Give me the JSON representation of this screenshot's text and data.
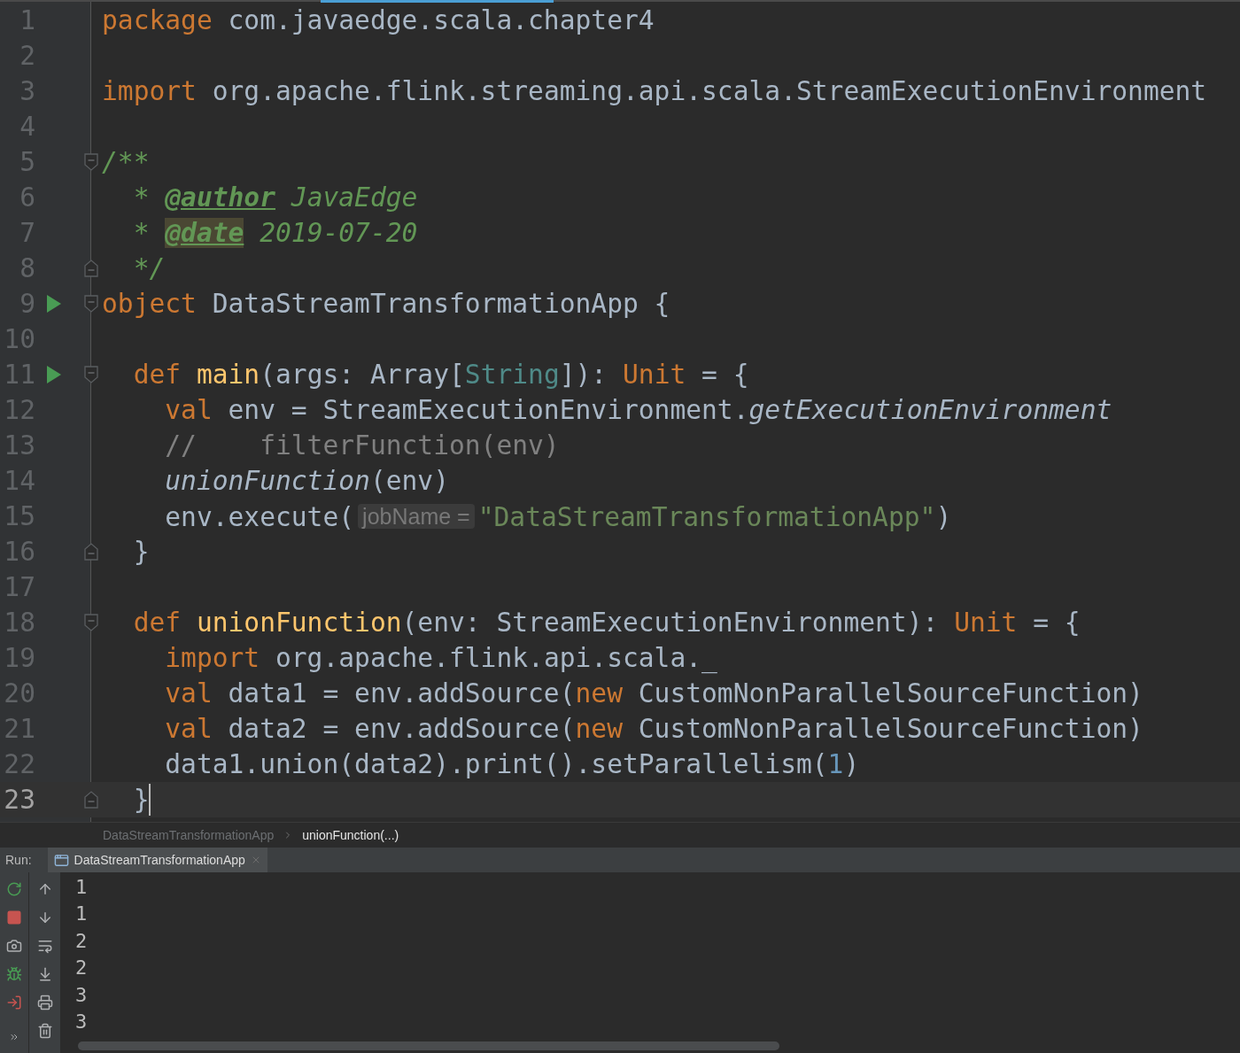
{
  "editor": {
    "lines": [
      {
        "number": "1",
        "run": false,
        "fold_start": false,
        "fold_end": false,
        "current": false,
        "tokens": [
          {
            "kind": "keyword",
            "text": "package"
          },
          {
            "kind": "plain",
            "text": " com.javaedge.scala.chapter4"
          }
        ]
      },
      {
        "number": "2",
        "run": false,
        "fold_start": false,
        "fold_end": false,
        "current": false
      },
      {
        "number": "3",
        "run": false,
        "fold_start": false,
        "fold_end": false,
        "current": false,
        "tokens": [
          {
            "kind": "keyword",
            "text": "import"
          },
          {
            "kind": "plain",
            "text": " org.apache.flink.streaming.api.scala.StreamExecutionEnvironment"
          }
        ]
      },
      {
        "number": "4",
        "run": false,
        "fold_start": false,
        "fold_end": false,
        "current": false
      },
      {
        "number": "5",
        "run": false,
        "fold_start": true,
        "fold_end": false,
        "current": false,
        "tokens": [
          {
            "kind": "doc",
            "text": "/**"
          }
        ]
      },
      {
        "number": "6",
        "run": false,
        "fold_start": false,
        "fold_end": false,
        "current": false,
        "tokens": [
          {
            "kind": "doc",
            "text": "  * "
          },
          {
            "kind": "doctag",
            "text": "@author"
          },
          {
            "kind": "doc",
            "text": " JavaEdge"
          }
        ]
      },
      {
        "number": "7",
        "run": false,
        "fold_start": false,
        "fold_end": false,
        "current": false,
        "tokens": [
          {
            "kind": "doc",
            "text": "  * "
          },
          {
            "kind": "marked",
            "text": "@date"
          },
          {
            "kind": "doc",
            "text": " 2019-07-20"
          }
        ]
      },
      {
        "number": "8",
        "run": false,
        "fold_start": false,
        "fold_end": true,
        "current": false,
        "tokens": [
          {
            "kind": "doc",
            "text": "  */"
          }
        ]
      },
      {
        "number": "9",
        "run": true,
        "fold_start": true,
        "fold_end": false,
        "current": false,
        "tokens": [
          {
            "kind": "keyword",
            "text": "object"
          },
          {
            "kind": "plain",
            "text": " DataStreamTransformationApp {"
          }
        ]
      },
      {
        "number": "10",
        "run": false,
        "fold_start": false,
        "fold_end": false,
        "current": false
      },
      {
        "number": "11",
        "run": true,
        "fold_start": true,
        "fold_end": false,
        "current": false,
        "tokens": [
          {
            "kind": "keyword",
            "text": "  def "
          },
          {
            "kind": "def",
            "text": "main"
          },
          {
            "kind": "plain",
            "text": "(args: Array["
          },
          {
            "kind": "type",
            "text": "String"
          },
          {
            "kind": "plain",
            "text": "]): "
          },
          {
            "kind": "keyword",
            "text": "Unit"
          },
          {
            "kind": "plain",
            "text": " = {"
          }
        ]
      },
      {
        "number": "12",
        "run": false,
        "fold_start": false,
        "fold_end": false,
        "current": false,
        "tokens": [
          {
            "kind": "keyword",
            "text": "    val"
          },
          {
            "kind": "plain",
            "text": " env = StreamExecutionEnvironment."
          },
          {
            "kind": "static",
            "text": "getExecutionEnvironment"
          }
        ]
      },
      {
        "number": "13",
        "run": false,
        "fold_start": false,
        "fold_end": false,
        "current": false,
        "tokens": [
          {
            "kind": "comment",
            "text": "    //    filterFunction(env)"
          }
        ]
      },
      {
        "number": "14",
        "run": false,
        "fold_start": false,
        "fold_end": false,
        "current": false,
        "tokens": [
          {
            "kind": "static",
            "text": "    unionFunction"
          },
          {
            "kind": "plain",
            "text": "(env)"
          }
        ]
      },
      {
        "number": "15",
        "run": false,
        "fold_start": false,
        "fold_end": false,
        "current": false,
        "tokens": [
          {
            "kind": "plain",
            "text": "    env.execute("
          },
          {
            "kind": "hint",
            "text": "jobName ="
          },
          {
            "kind": "string",
            "text": "\"DataStreamTransformationApp\""
          },
          {
            "kind": "plain",
            "text": ")"
          }
        ]
      },
      {
        "number": "16",
        "run": false,
        "fold_start": false,
        "fold_end": true,
        "current": false,
        "tokens": [
          {
            "kind": "plain",
            "text": "  }"
          }
        ]
      },
      {
        "number": "17",
        "run": false,
        "fold_start": false,
        "fold_end": false,
        "current": false
      },
      {
        "number": "18",
        "run": false,
        "fold_start": true,
        "fold_end": false,
        "current": false,
        "tokens": [
          {
            "kind": "keyword",
            "text": "  def "
          },
          {
            "kind": "def",
            "text": "unionFunction"
          },
          {
            "kind": "plain",
            "text": "(env: StreamExecutionEnvironment): "
          },
          {
            "kind": "keyword",
            "text": "Unit"
          },
          {
            "kind": "plain",
            "text": " = {"
          }
        ]
      },
      {
        "number": "19",
        "run": false,
        "fold_start": false,
        "fold_end": false,
        "current": false,
        "tokens": [
          {
            "kind": "keyword",
            "text": "    import"
          },
          {
            "kind": "plain",
            "text": " org.apache.flink.api.scala._"
          }
        ]
      },
      {
        "number": "20",
        "run": false,
        "fold_start": false,
        "fold_end": false,
        "current": false,
        "tokens": [
          {
            "kind": "keyword",
            "text": "    val"
          },
          {
            "kind": "plain",
            "text": " data1 = env.addSource("
          },
          {
            "kind": "keyword",
            "text": "new"
          },
          {
            "kind": "plain",
            "text": " CustomNonParallelSourceFunction)"
          }
        ]
      },
      {
        "number": "21",
        "run": false,
        "fold_start": false,
        "fold_end": false,
        "current": false,
        "tokens": [
          {
            "kind": "keyword",
            "text": "    val"
          },
          {
            "kind": "plain",
            "text": " data2 = env.addSource("
          },
          {
            "kind": "keyword",
            "text": "new"
          },
          {
            "kind": "plain",
            "text": " CustomNonParallelSourceFunction)"
          }
        ]
      },
      {
        "number": "22",
        "run": false,
        "fold_start": false,
        "fold_end": false,
        "current": false,
        "tokens": [
          {
            "kind": "plain",
            "text": "    data1.union(data2).print().setParallelism("
          },
          {
            "kind": "number",
            "text": "1"
          },
          {
            "kind": "plain",
            "text": ")"
          }
        ]
      },
      {
        "number": "23",
        "run": false,
        "fold_start": false,
        "fold_end": true,
        "current": true,
        "tokens": [
          {
            "kind": "plain",
            "text": "  }"
          }
        ]
      }
    ]
  },
  "breadcrumbs": [
    {
      "label": "DataStreamTransformationApp",
      "selected": false
    },
    {
      "label": "unionFunction(...)",
      "selected": true
    }
  ],
  "run_panel": {
    "label": "Run:",
    "tabs": [
      {
        "title": "DataStreamTransformationApp",
        "selected": true
      }
    ],
    "output": [
      "1",
      "1",
      "2",
      "2",
      "3",
      "3"
    ]
  }
}
